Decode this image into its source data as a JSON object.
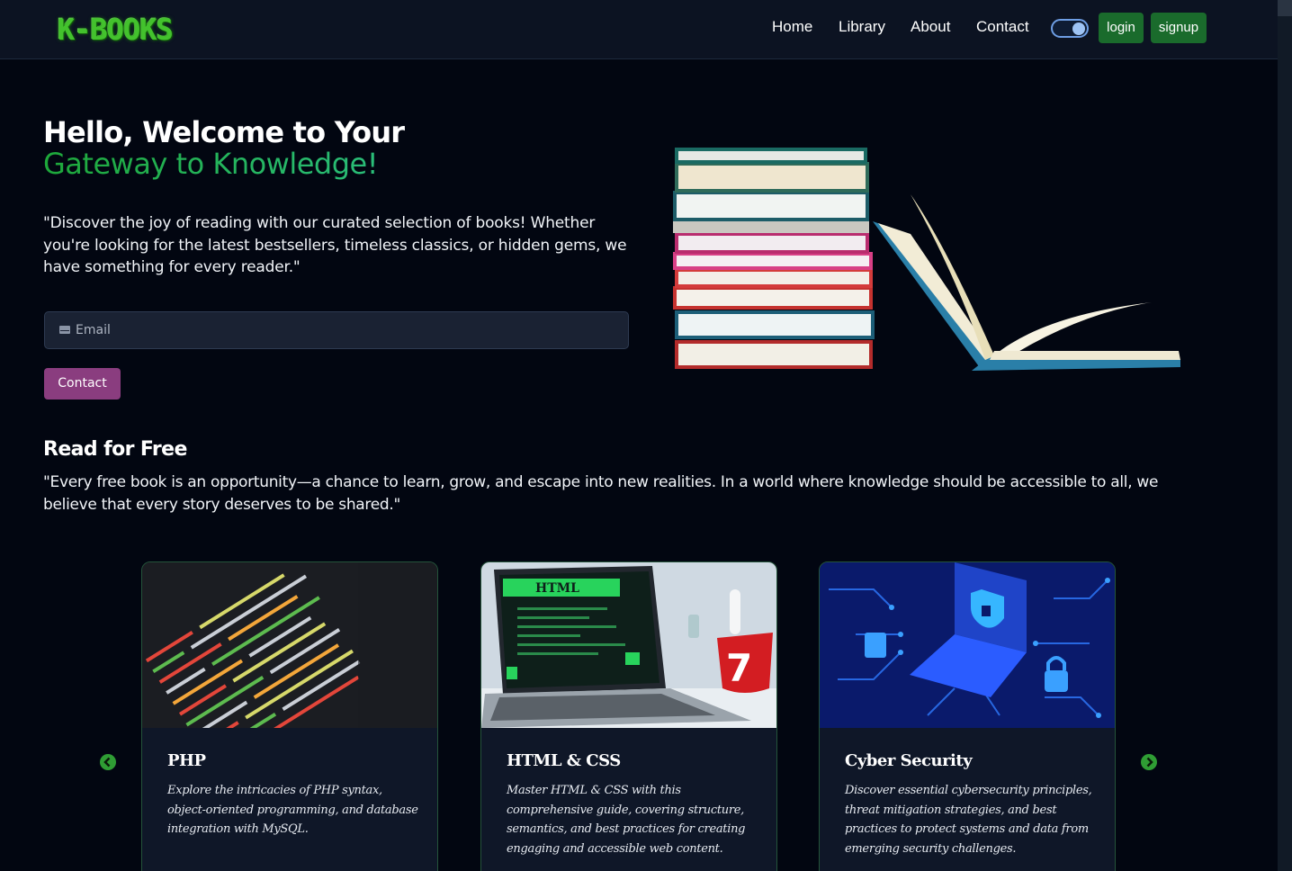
{
  "navbar": {
    "logo": "K-BOOKS",
    "links": [
      "Home",
      "Library",
      "About",
      "Contact"
    ],
    "login_label": "login",
    "signup_label": "signup"
  },
  "hero": {
    "title_line1": "Hello, Welcome to Your",
    "title_line2": "Gateway to Knowledge!",
    "description": "\"Discover the joy of reading with our curated selection of books! Whether you're looking for the latest bestsellers, timeless classics, or hidden gems, we have something for every reader.\"",
    "email_placeholder": "Email",
    "contact_label": "Contact"
  },
  "read_free": {
    "title": "Read for Free",
    "description": "\"Every free book is an opportunity—a chance to learn, grow, and escape into new realities. In a world where knowledge should be accessible to all, we believe that every story deserves to be shared.\""
  },
  "cards": [
    {
      "title": "PHP",
      "text": "Explore the intricacies of PHP syntax, object-oriented programming, and database integration with MySQL."
    },
    {
      "title": "HTML & CSS",
      "text": "Master HTML & CSS with this comprehensive guide, covering structure, semantics, and best practices for creating engaging and accessible web content.",
      "image_label": "HTML",
      "mug_number": "7"
    },
    {
      "title": "Cyber Security",
      "text": "Discover essential cybersecurity principles, threat mitigation strategies, and best practices to protect systems and data from emerging security challenges."
    }
  ],
  "colors": {
    "background": "#020611",
    "navbar": "#0c1322",
    "accent_green": "#1a6b2c",
    "contact_purple": "#8a3d7f",
    "title_gradient_start": "#1ea83a",
    "title_gradient_end": "#2bbf7e"
  },
  "icons": {
    "email": "envelope-icon",
    "prev": "chevron-left-icon",
    "next": "chevron-right-icon",
    "theme_toggle": "toggle-switch"
  }
}
